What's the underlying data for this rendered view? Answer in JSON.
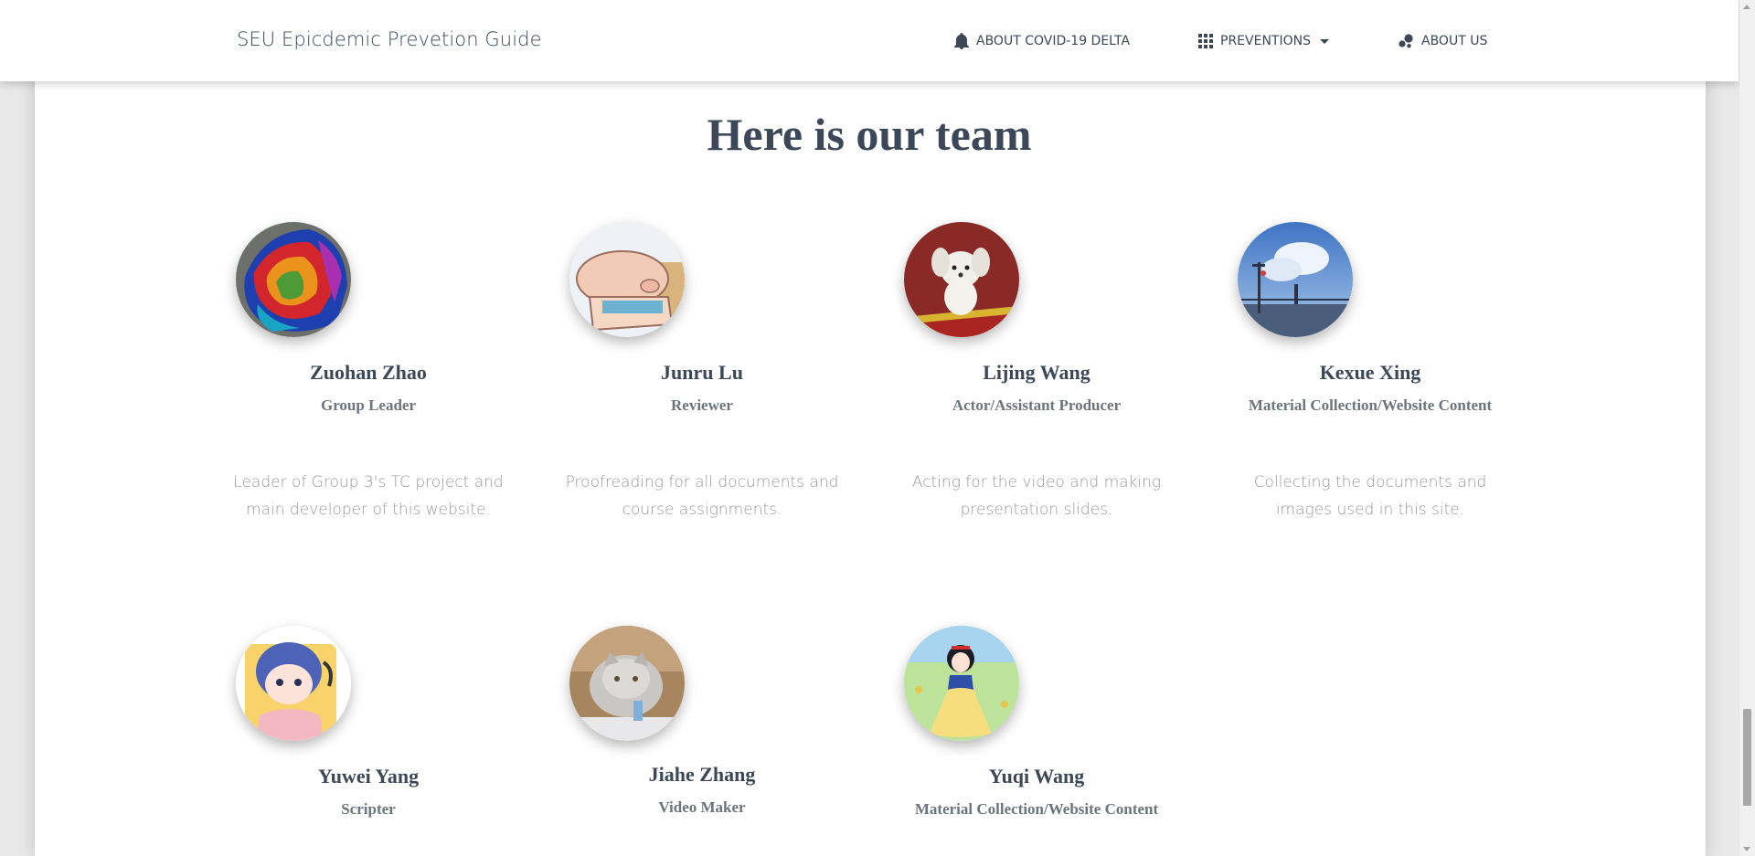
{
  "navbar": {
    "brand": "SEU Epicdemic Prevetion Guide",
    "items": [
      {
        "label": "ABOUT COVID-19 DELTA",
        "icon": "bell-icon"
      },
      {
        "label": "PREVENTIONS",
        "icon": "grid-icon",
        "has_dropdown": true
      },
      {
        "label": "ABOUT US",
        "icon": "bubble-chart-icon"
      }
    ]
  },
  "section": {
    "title": "Here is our team"
  },
  "team": [
    {
      "name": "Zuohan Zhao",
      "role": "Group Leader",
      "desc": [
        "Leader of Group 3's TC project and",
        "main developer of this website."
      ],
      "avatar": "abstract-painting-avatar"
    },
    {
      "name": "Junru Lu",
      "role": "Reviewer",
      "desc": [
        "Proofreading for all documents and",
        "course assignments."
      ],
      "avatar": "pig-avatar"
    },
    {
      "name": "Lijing Wang",
      "role": "Actor/Assistant Producer",
      "desc": [
        "Acting for the video and making",
        "presentation slides."
      ],
      "avatar": "white-dog-avatar"
    },
    {
      "name": "Kexue Xing",
      "role": "Material Collection/Website Content",
      "desc": [
        "Collecting the documents and",
        "images used in this site."
      ],
      "avatar": "sky-scene-avatar"
    },
    {
      "name": "Yuwei Yang",
      "role": "Scripter",
      "avatar": "anime-girl-avatar"
    },
    {
      "name": "Jiahe Zhang",
      "role": "Video Maker",
      "avatar": "cat-avatar"
    },
    {
      "name": "Yuqi Wang",
      "role": "Material Collection/Website Content",
      "avatar": "princess-avatar"
    }
  ],
  "colors": {
    "heading": "#3c4858",
    "muted": "#999999",
    "role": "#6c757d"
  }
}
